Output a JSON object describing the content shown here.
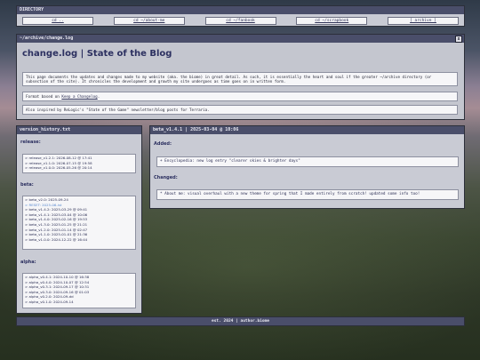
{
  "directory": {
    "title": "DIRECTORY",
    "links": [
      "cd ..",
      "cd ~/about-me",
      "cd ~/fanbook",
      "cd ~/scrapbook",
      "[ archive ]"
    ]
  },
  "changelog": {
    "window_title": "~/archive/change.log",
    "close_label": "x",
    "heading": "change.log | State of the Blog",
    "description": "This page documents the updates and changes made to my website (aka. the biome) in great detail. As such, it is essentially the heart and soul if the greater ~/archive directory (or subsection of the site). It chronicles the development and growth my site undergoes as time goes on in written form.",
    "format_prefix": "Format based on ",
    "format_link": "Keep a Changelog",
    "format_suffix": ".",
    "inspiration": "Also inspired by ReLogic's \"State of the Game\" newsletter/blog posts for Terraria."
  },
  "history": {
    "window_title": "version_history.txt",
    "release_label": "release:",
    "release": [
      "> release_v1.2.1: 2026-08-12 @ 17:41",
      "> release_v1.1.0: 2026-07-15 @ 19:58",
      "> release_v1.0.0: 2026-05-26 @ 20:14"
    ],
    "beta_label": "beta:",
    "beta": [
      "> beta_v2.0: 2025-09-24",
      "> RESET: 2025-06-ist",
      "> beta_v1.4.2: 2025-03-29 @ 09:41",
      "> beta_v1.4.1: 2025-03-04 @ 10:06",
      "> beta_v1.4.0: 2025-02-16 @ 19:53",
      "> beta_v1.3.0: 2025-01-25 @ 21:21",
      "> beta_v1.2.0: 2025-01-14 @ 02:47",
      "> beta_v1.1.0: 2025-01-01 @ 21:36",
      "> beta_v1.0.0: 2024-12-22 @ 16:44"
    ],
    "alpha_label": "alpha:",
    "alpha": [
      "> alpha_v0.4.1: 2024-10-10 @ 16:38",
      "> alpha_v0.4.0: 2024-10-07 @ 12:54",
      "> alpha_v0.3.1: 2024-09-17 @ 10:31",
      "> alpha_v0.3.0: 2024-09-16 @ 01:03",
      "> alpha_v0.2.0: 2024-09-dd",
      "> alpha_v0.1.0: 2024-09-14"
    ]
  },
  "detail": {
    "window_title": "beta_v1.4.1 | 2025-03-04 @ 10:06",
    "added_label": "Added:",
    "added_entry": "+ Encyclopedia: new log entry \"clearer skies & brighter days\"",
    "changed_label": "Changed:",
    "changed_entry": "* About me: visual overhaul with a new theme for spring that I made entirely from scratch! updated some info too!"
  },
  "footer": {
    "text": "est. 2024 | author.biome"
  },
  "colors": {
    "titlebar": "#4a4e6a",
    "panel": "#c9cbd4",
    "link": "#2e3156",
    "accent_reset": "#5b8ad0"
  }
}
